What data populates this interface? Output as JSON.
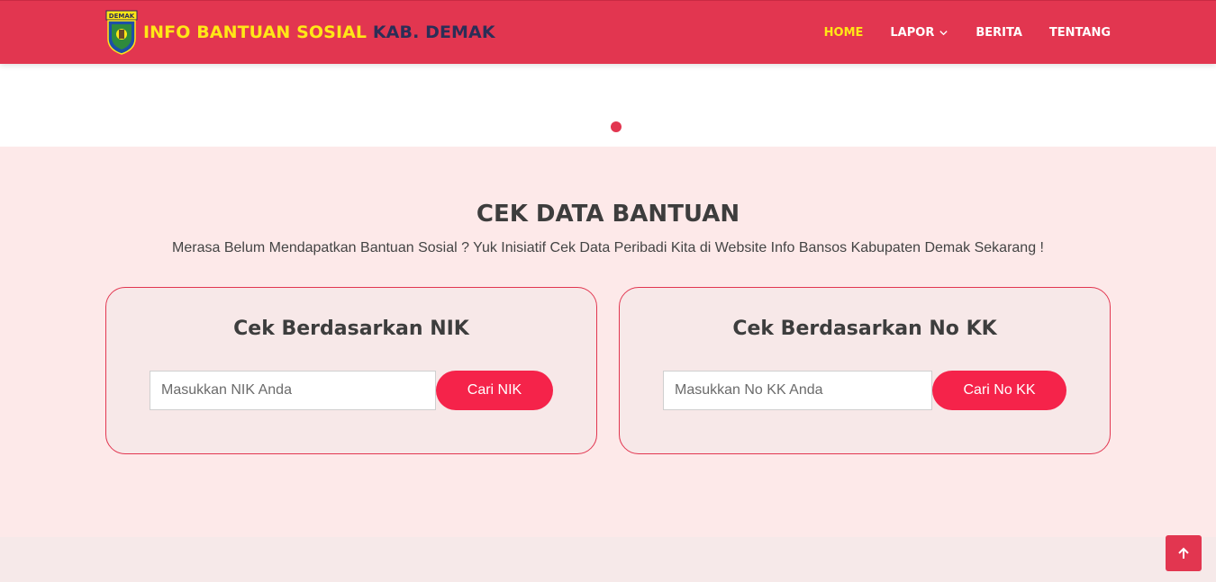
{
  "brand": {
    "title_main": "INFO BANTUAN SOSIAL",
    "title_sub": "KAB. DEMAK",
    "logo_text": "DEMAK"
  },
  "nav": {
    "items": [
      {
        "label": "HOME",
        "active": true
      },
      {
        "label": "LAPOR",
        "dropdown": true
      },
      {
        "label": "BERITA"
      },
      {
        "label": "TENTANG"
      }
    ]
  },
  "section": {
    "title": "CEK DATA BANTUAN",
    "subtitle": "Merasa Belum Mendapatkan Bantuan Sosial ? Yuk Inisiatif Cek Data Peribadi Kita di Website Info Bansos Kabupaten Demak Sekarang !"
  },
  "nik_card": {
    "heading": "Cek Berdasarkan NIK",
    "placeholder": "Masukkan NIK Anda",
    "value": "",
    "button_label": "Cari NIK"
  },
  "kk_card": {
    "heading": "Cek Berdasarkan No KK",
    "placeholder": "Masukkan No KK Anda",
    "value": "",
    "button_label": "Cari No KK"
  },
  "icons": {
    "back_to_top": "arrow-up-icon",
    "dropdown": "chevron-down-icon",
    "logo": "demak-emblem-icon"
  },
  "colors": {
    "primary": "#e23650",
    "accent_yellow": "#ffe716",
    "brand_dark": "#2b2e57",
    "button": "#f5234a",
    "section_bg": "#fde9e9"
  }
}
